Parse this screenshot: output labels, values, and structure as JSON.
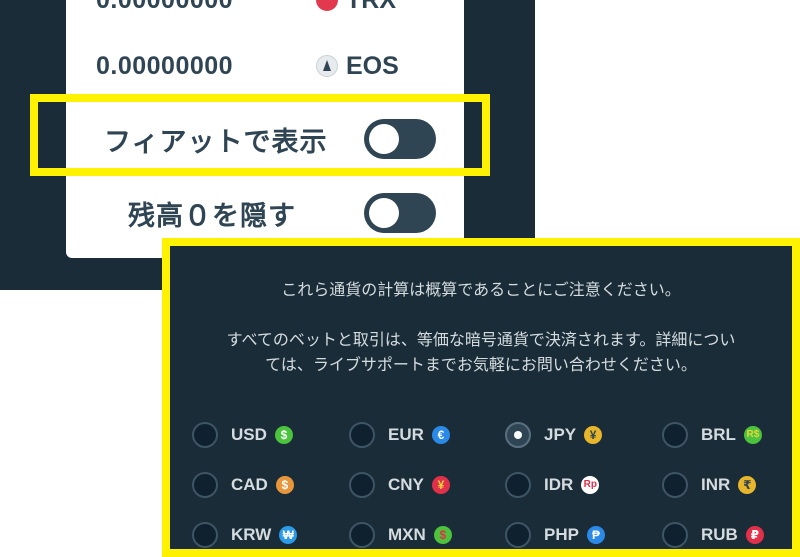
{
  "wallet": {
    "balances": [
      {
        "amount": "0.00000000",
        "coin": "TRX",
        "icon": "trx-icon",
        "color": "#e2394e"
      },
      {
        "amount": "0.00000000",
        "coin": "EOS",
        "icon": "eos-icon",
        "color": "#2f4553"
      }
    ],
    "toggles": {
      "fiat_label": "フィアットで表示",
      "hide_zero_label": "残高０を隠す"
    }
  },
  "notice": {
    "line1": "これら通貨の計算は概算であることにご注意ください。",
    "line2": "すべてのベットと取引は、等価な暗号通貨で決済されます。詳細につい",
    "line3": "ては、ライブサポートまでお気軽にお問い合わせください。"
  },
  "currencies": [
    {
      "code": "USD",
      "symbol": "$",
      "color": "#4bc33d",
      "selected": false
    },
    {
      "code": "EUR",
      "symbol": "€",
      "color": "#2b8ae8",
      "selected": false
    },
    {
      "code": "JPY",
      "symbol": "¥",
      "color": "#e8b62b",
      "selected": true
    },
    {
      "code": "BRL",
      "symbol": "R$",
      "color": "#4bc33d",
      "selected": false
    },
    {
      "code": "CAD",
      "symbol": "$",
      "color": "#e8963b",
      "selected": false
    },
    {
      "code": "CNY",
      "symbol": "¥",
      "color": "#e2304a",
      "selected": false
    },
    {
      "code": "IDR",
      "symbol": "Rp",
      "color": "#ffffff",
      "selected": false
    },
    {
      "code": "INR",
      "symbol": "₹",
      "color": "#e8b62b",
      "selected": false
    },
    {
      "code": "KRW",
      "symbol": "₩",
      "color": "#2b9ae8",
      "selected": false
    },
    {
      "code": "MXN",
      "symbol": "$",
      "color": "#e8463b",
      "selected": false
    },
    {
      "code": "PHP",
      "symbol": "₱",
      "color": "#2b8ae8",
      "selected": false
    },
    {
      "code": "RUB",
      "symbol": "₽",
      "color": "#e2304a",
      "selected": false
    }
  ]
}
